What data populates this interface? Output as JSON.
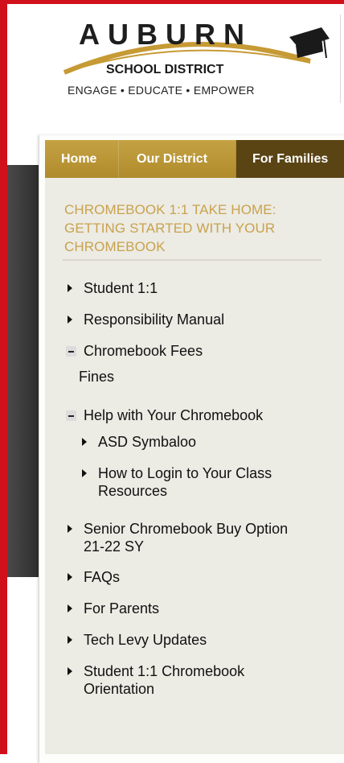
{
  "logo": {
    "wordmark": "AUBURN",
    "subtitle": "SCHOOL DISTRICT",
    "tagline": "ENGAGE • EDUCATE • EMPOWER"
  },
  "nav": {
    "home": "Home",
    "our_district": "Our District",
    "for_families": "For Families"
  },
  "section": {
    "title": "CHROMEBOOK 1:1 TAKE HOME: GETTING STARTED WITH YOUR CHROMEBOOK"
  },
  "menu": {
    "student_1_1": "Student 1:1",
    "responsibility_manual": "Responsibility Manual",
    "chromebook_fees": "Chromebook Fees",
    "fines": "Fines",
    "help": "Help with Your Chromebook",
    "asd_symbaloo": "ASD Symbaloo",
    "how_to_login_1": "How to Login to Your Class",
    "how_to_login_2": "Resources",
    "senior_buy_1": "Senior Chromebook Buy Option",
    "senior_buy_2": "21-22 SY",
    "faqs": "FAQs",
    "for_parents": "For Parents",
    "tech_levy": "Tech Levy Updates",
    "orientation_1": "Student 1:1 Chromebook",
    "orientation_2": "Orientation"
  },
  "colors": {
    "brand_red": "#d0101a",
    "nav_gold": "#b08b2c",
    "nav_active": "#5a4414",
    "title_gold": "#c9a24c"
  }
}
